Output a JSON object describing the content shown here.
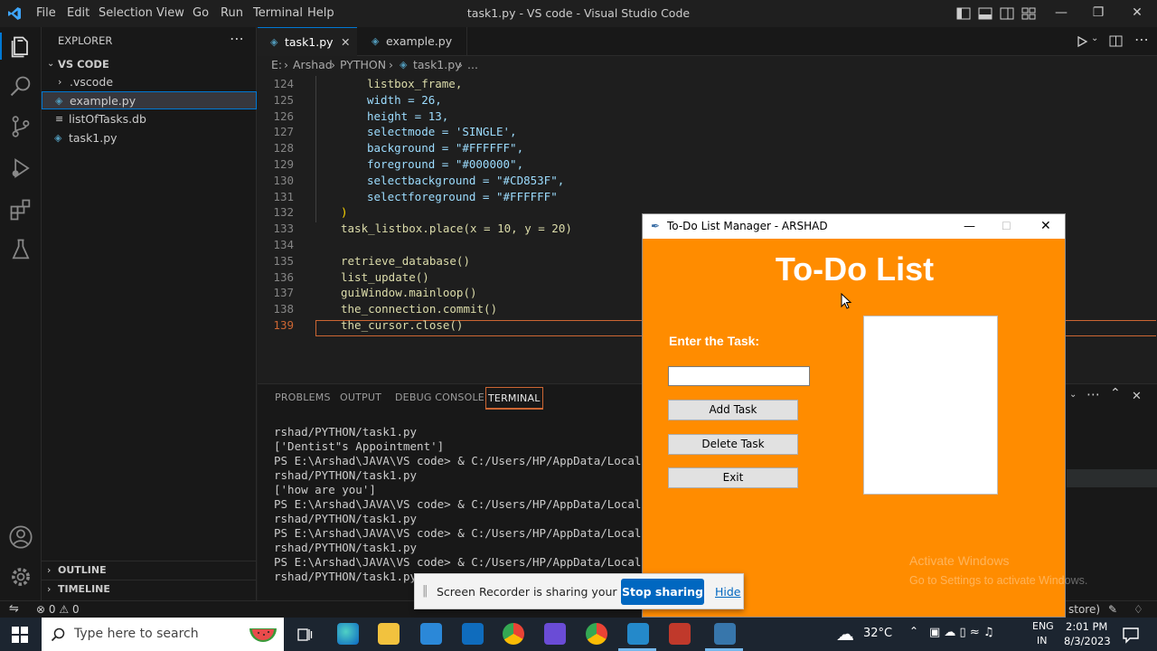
{
  "colors": {
    "accent": "#0078d4",
    "tk_bg": "#ff8c00",
    "orange_line": "#cc6633"
  },
  "titlebar": {
    "menus": [
      "File",
      "Edit",
      "Selection",
      "View",
      "Go",
      "Run",
      "Terminal",
      "Help"
    ],
    "title": "task1.py - VS code - Visual Studio Code"
  },
  "sidebar": {
    "header": "EXPLORER",
    "root": "VS CODE",
    "items": [
      ".vscode",
      "example.py",
      "listOfTasks.db",
      "task1.py"
    ],
    "outline": "OUTLINE",
    "timeline": "TIMELINE"
  },
  "tabs": [
    "task1.py",
    "example.py"
  ],
  "breadcrumb": [
    "E:",
    "Arshad",
    "PYTHON",
    "task1.py",
    "..."
  ],
  "code": {
    "line_numbers": [
      "124",
      "125",
      "126",
      "127",
      "128",
      "129",
      "130",
      "131",
      "132",
      "133",
      "134",
      "135",
      "136",
      "137",
      "138",
      "139"
    ],
    "lines": [
      "listbox_frame,",
      "width = 26,",
      "height = 13,",
      "selectmode = 'SINGLE',",
      "background = \"#FFFFFF\",",
      "foreground = \"#000000\",",
      "selectbackground = \"#CD853F\",",
      "selectforeground = \"#FFFFFF\"",
      ")",
      "task_listbox.place(x = 10, y = 20)",
      "",
      "retrieve_database()",
      "list_update()",
      "guiWindow.mainloop()",
      "the_connection.commit()",
      "the_cursor.close()"
    ]
  },
  "panel": {
    "tabs": [
      "PROBLEMS",
      "OUTPUT",
      "DEBUG CONSOLE",
      "TERMINAL"
    ],
    "terminal": [
      "rshad/PYTHON/task1.py",
      "['Dentist\"s Appointment']",
      "PS E:\\Arshad\\JAVA\\VS code> & C:/Users/HP/AppData/Local/Microso",
      "rshad/PYTHON/task1.py",
      "['how are you']",
      "PS E:\\Arshad\\JAVA\\VS code> & C:/Users/HP/AppData/Local/Microso",
      "rshad/PYTHON/task1.py",
      "PS E:\\Arshad\\JAVA\\VS code> & C:/Users/HP/AppData/Local/Microso",
      "rshad/PYTHON/task1.py",
      "PS E:\\Arshad\\JAVA\\VS code> & C:/Users/HP/AppData/Local/Microso",
      "rshad/PYTHON/task1.py"
    ]
  },
  "status": {
    "errors": "0",
    "warnings": "0",
    "right_text": "store)"
  },
  "tkwindow": {
    "title": "To-Do List Manager - ARSHAD",
    "heading": "To-Do List",
    "label": "Enter the Task:",
    "buttons": {
      "add": "Add Task",
      "delete": "Delete Task",
      "exit": "Exit"
    },
    "watermark1": "Activate Windows",
    "watermark2": "Go to Settings to activate Windows."
  },
  "share": {
    "message": "Screen Recorder is sharing your screen.",
    "stop": "Stop sharing",
    "hide": "Hide"
  },
  "taskbar": {
    "search_placeholder": "Type here to search",
    "temp": "32°C",
    "lang1": "ENG",
    "lang2": "IN",
    "time": "2:01 PM",
    "date": "8/3/2023"
  }
}
